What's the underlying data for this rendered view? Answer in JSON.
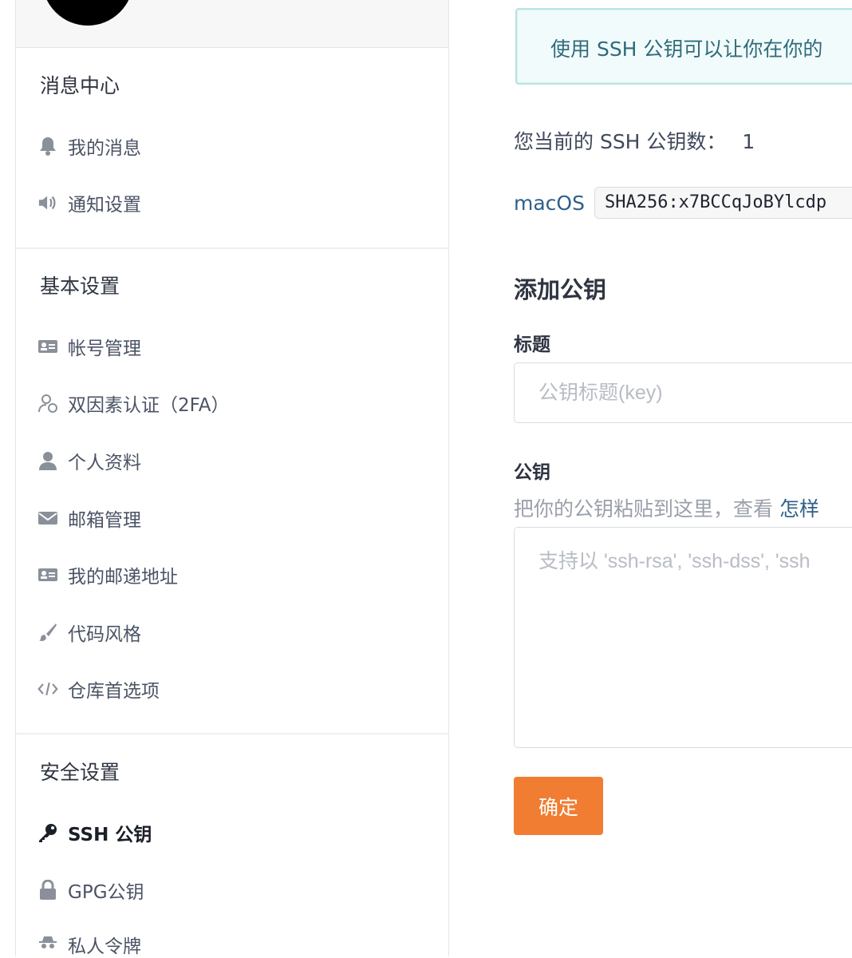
{
  "sidebar": {
    "sections": [
      {
        "title": "消息中心",
        "items": [
          {
            "label": "我的消息",
            "icon": "bell-icon"
          },
          {
            "label": "通知设置",
            "icon": "speaker-icon"
          }
        ]
      },
      {
        "title": "基本设置",
        "items": [
          {
            "label": "帐号管理",
            "icon": "id-card-icon"
          },
          {
            "label": "双因素认证（2FA）",
            "icon": "user-outline-icon"
          },
          {
            "label": "个人资料",
            "icon": "user-icon"
          },
          {
            "label": "邮箱管理",
            "icon": "envelope-icon"
          },
          {
            "label": "我的邮递地址",
            "icon": "id-card-icon"
          },
          {
            "label": "代码风格",
            "icon": "paint-brush-icon"
          },
          {
            "label": "仓库首选项",
            "icon": "code-icon"
          }
        ]
      },
      {
        "title": "安全设置",
        "items": [
          {
            "label": "SSH 公钥",
            "icon": "key-icon",
            "active": true
          },
          {
            "label": "GPG公钥",
            "icon": "lock-icon"
          },
          {
            "label": "私人令牌",
            "icon": "spy-icon"
          }
        ]
      }
    ]
  },
  "main": {
    "info_text": "使用 SSH 公钥可以让你在你的",
    "count_label": "您当前的 SSH 公钥数：",
    "count_value": "1",
    "keys": [
      {
        "name": "macOS",
        "fingerprint": "SHA256:x7BCCqJoBYlcdp"
      }
    ],
    "add_title": "添加公钥",
    "title_label": "标题",
    "title_placeholder": "公钥标题(key)",
    "key_label": "公钥",
    "hint_text": "把你的公钥粘贴到这里，查看 ",
    "hint_link": "怎样",
    "key_placeholder": "支持以 'ssh-rsa', 'ssh-dss', 'ssh",
    "submit_label": "确定"
  },
  "colors": {
    "accent": "#f07d32",
    "link": "#2f5f8a",
    "info_border": "#b7e4e6",
    "info_bg": "#f2fbfb"
  }
}
